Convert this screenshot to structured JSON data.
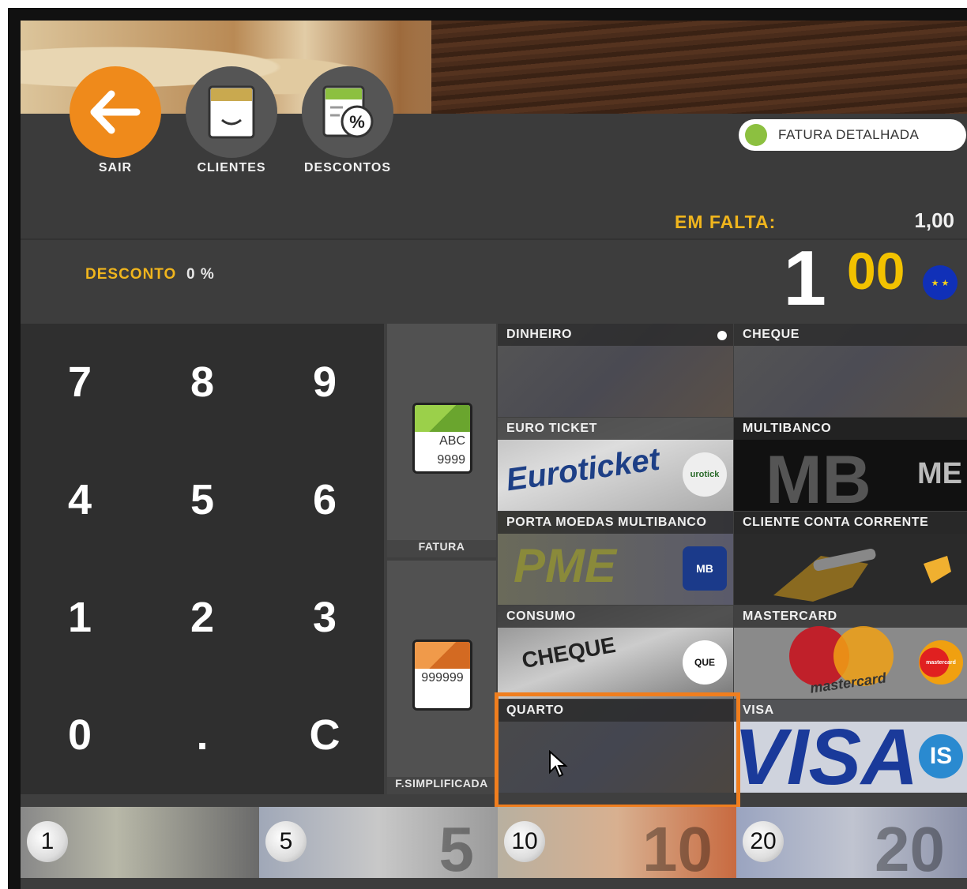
{
  "header": {
    "buttons": [
      {
        "label": "SAIR",
        "icon": "back-arrow-icon"
      },
      {
        "label": "CLIENTES",
        "icon": "client-card-icon"
      },
      {
        "label": "DESCONTOS",
        "icon": "discount-percent-icon"
      }
    ],
    "toggle_label": "FATURA DETALHADA"
  },
  "summary": {
    "em_falta_label": "EM FALTA:",
    "em_falta_value": "1,00",
    "desconto_label": "DESCONTO",
    "desconto_value": "0 %",
    "total_int": "1",
    "total_dec": "00"
  },
  "keypad": {
    "keys": [
      "7",
      "8",
      "9",
      "4",
      "5",
      "6",
      "1",
      "2",
      "3",
      "0",
      ".",
      "C"
    ]
  },
  "documents": [
    {
      "label": "FATURA",
      "icon_text_1": "ABC",
      "icon_text_2": "9999",
      "color": "#7cbd3a"
    },
    {
      "label": "F.SIMPLIFICADA",
      "icon_text_1": "999999",
      "color": "#e07a2c"
    }
  ],
  "payments": [
    {
      "label": "DINHEIRO"
    },
    {
      "label": "CHEQUE"
    },
    {
      "label": "EURO TICKET"
    },
    {
      "label": "MULTIBANCO"
    },
    {
      "label": "PORTA MOEDAS MULTIBANCO"
    },
    {
      "label": "CLIENTE CONTA CORRENTE"
    },
    {
      "label": "CONSUMO"
    },
    {
      "label": "MASTERCARD"
    },
    {
      "label": "QUARTO"
    },
    {
      "label": "VISA"
    }
  ],
  "payment_art": {
    "euroticket": "Euroticket",
    "euroticket_badge": "urotick",
    "mb": "MB",
    "mb_badge": "ME",
    "pme": "PME",
    "pme_badge": "MB",
    "cheque": "CHEQUE",
    "cheque_badge": "QUE",
    "mastercard": "mastercard",
    "mastercard_badge": "mastercard",
    "visa": "VISA",
    "visa_badge": "IS"
  },
  "notes": [
    {
      "value": "1"
    },
    {
      "value": "5"
    },
    {
      "value": "10"
    },
    {
      "value": "20"
    }
  ],
  "colors": {
    "accent_orange": "#ef8a1b",
    "label_yellow": "#f0b51d",
    "toggle_green": "#8cc040",
    "selection_orange": "#f07e1e"
  }
}
